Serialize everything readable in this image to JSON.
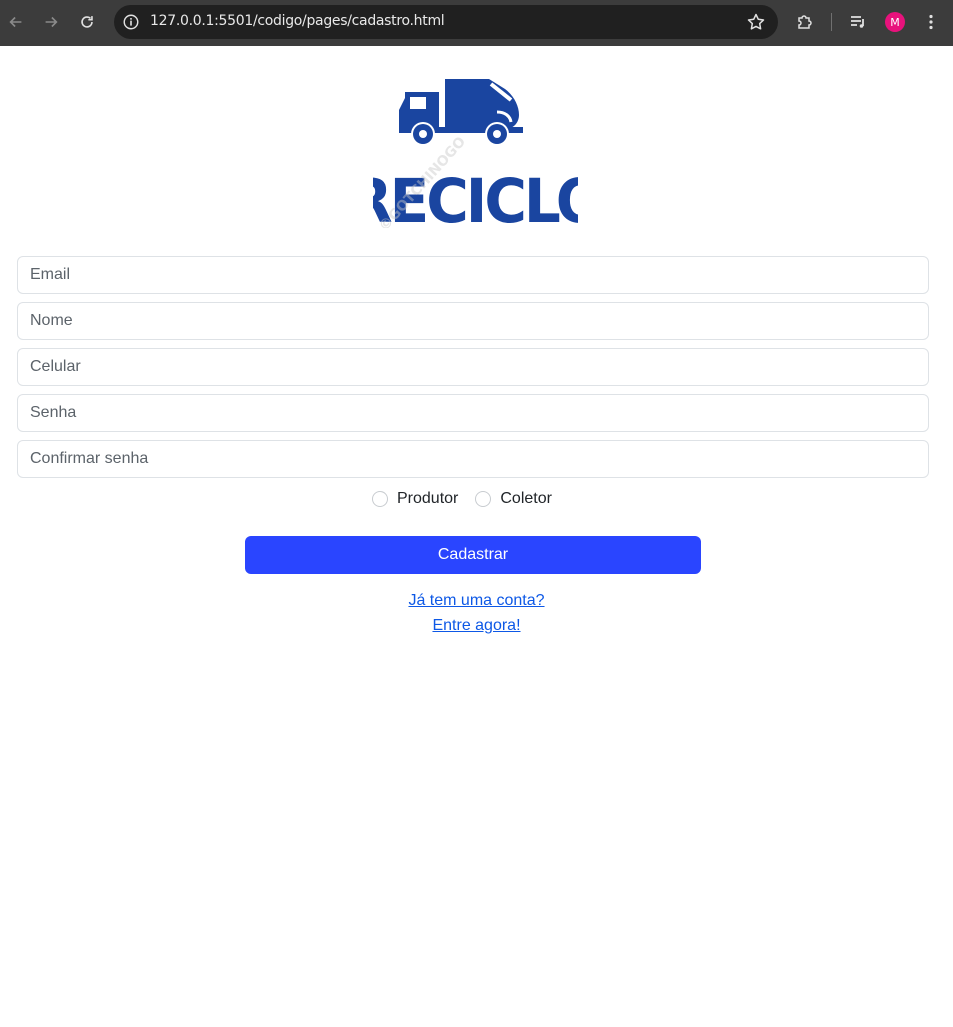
{
  "browser": {
    "url": "127.0.0.1:5501/codigo/pages/cadastro.html",
    "profile_initial": "M",
    "profile_color": "#e8127c"
  },
  "logo": {
    "text": "RECICLO",
    "watermark": "©GOTCHINOGO",
    "color": "#1a45a0"
  },
  "form": {
    "fields": [
      {
        "placeholder": "Email",
        "value": ""
      },
      {
        "placeholder": "Nome",
        "value": ""
      },
      {
        "placeholder": "Celular",
        "value": ""
      },
      {
        "placeholder": "Senha",
        "value": ""
      },
      {
        "placeholder": "Confirmar senha",
        "value": ""
      }
    ],
    "role_options": [
      "Produtor",
      "Coletor"
    ],
    "submit_label": "Cadastrar",
    "submit_color": "#2a45ff"
  },
  "login_prompt": {
    "question": "Já tem uma conta?",
    "action": "Entre agora!"
  }
}
